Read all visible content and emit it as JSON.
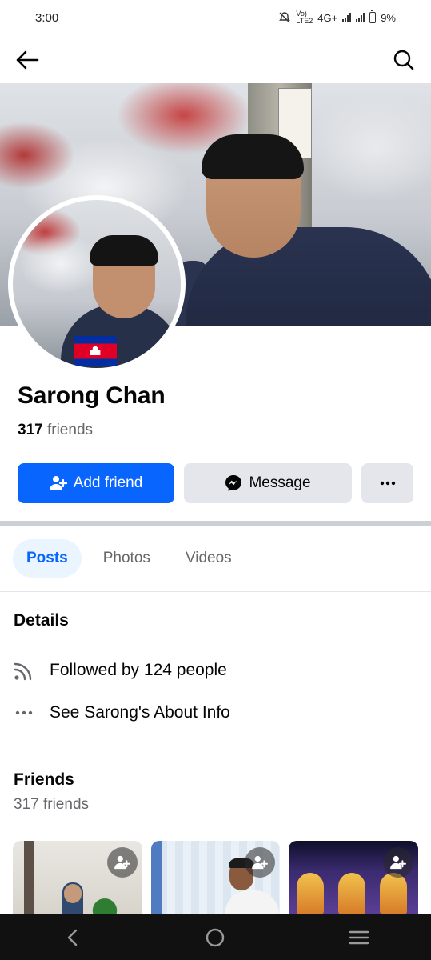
{
  "status_bar": {
    "time": "3:00",
    "network_top": "Vo)",
    "network_bottom": "LTE2",
    "network_type": "4G+",
    "battery_percent": "9%"
  },
  "nav": {
    "back_icon": "arrow-left-icon",
    "search_icon": "search-icon"
  },
  "profile": {
    "name": "Sarong Chan",
    "friends_count": "317",
    "friends_suffix": "friends"
  },
  "actions": {
    "add_friend": "Add friend",
    "message": "Message",
    "more_icon": "more-horizontal-icon"
  },
  "tabs": [
    {
      "label": "Posts",
      "active": true
    },
    {
      "label": "Photos",
      "active": false
    },
    {
      "label": "Videos",
      "active": false
    }
  ],
  "details": {
    "title": "Details",
    "items": [
      {
        "icon": "rss-icon",
        "text": "Followed by 124 people"
      },
      {
        "icon": "more-horizontal-icon",
        "text": "See Sarong's About Info"
      }
    ]
  },
  "friends_section": {
    "title": "Friends",
    "count_text": "317 friends"
  },
  "colors": {
    "primary": "#0866ff",
    "secondary_button": "#e4e6eb",
    "active_tab_bg": "#ebf5ff",
    "muted_text": "#65676b"
  }
}
